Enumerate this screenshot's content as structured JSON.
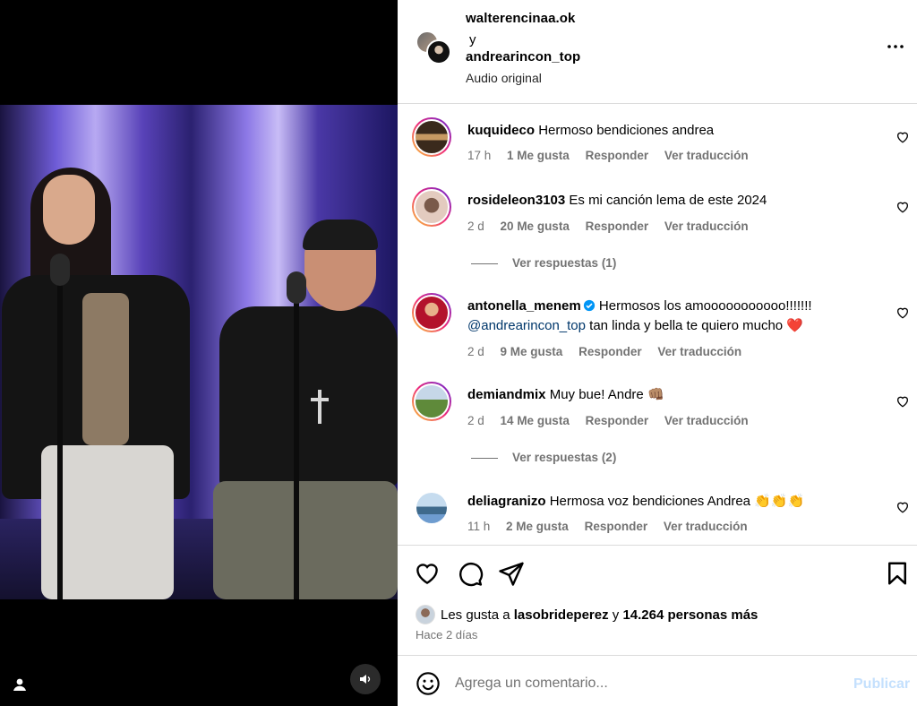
{
  "post": {
    "author1": "walterencinaa.ok",
    "joiner": "y",
    "author2": "andrearincon_top",
    "audio": "Audio original"
  },
  "comments": [
    {
      "user": "kuquideco",
      "text": "Hermoso bendiciones andrea",
      "time": "17 h",
      "likes": "1 Me gusta",
      "reply": "Responder",
      "translate": "Ver traducción",
      "avatar_colors": [
        "#3a2a1c",
        "#c79a63"
      ]
    },
    {
      "user": "rosideleon3103",
      "text": "Es mi canción lema de este 2024",
      "time": "2 d",
      "likes": "20 Me gusta",
      "reply": "Responder",
      "translate": "Ver traducción",
      "view_replies": "Ver respuestas (1)",
      "avatar_colors": [
        "#e3cbbf",
        "#7a5a4a"
      ]
    },
    {
      "user": "antonella_menem",
      "verified": true,
      "text": "Hermosos los amooooooooooo!!!!!!!",
      "mention": "@andrearincon_top",
      "text2": "tan linda y bella te quiero mucho",
      "emoji": "❤️",
      "time": "2 d",
      "likes": "9 Me gusta",
      "reply": "Responder",
      "translate": "Ver traducción",
      "avatar_colors": [
        "#b3122c",
        "#e8b08a"
      ]
    },
    {
      "user": "demiandmix",
      "text": "Muy bue! Andre",
      "emoji": "👊🏽",
      "time": "2 d",
      "likes": "14 Me gusta",
      "reply": "Responder",
      "translate": "Ver traducción",
      "view_replies": "Ver respuestas (2)",
      "avatar_colors": [
        "#5f8a3a",
        "#c6d7e8"
      ]
    },
    {
      "user": "deliagranizo",
      "text": "Hermosa voz bendiciones Andrea",
      "emoji": "👏👏👏",
      "time": "11 h",
      "likes": "2 Me gusta",
      "reply": "Responder",
      "translate": "Ver traducción",
      "avatar_colors": [
        "#6e9ccf",
        "#3f6a8c"
      ]
    }
  ],
  "likes": {
    "prefix": "Les gusta a",
    "user": "lasobrideperez",
    "joiner": "y",
    "others": "14.264 personas más"
  },
  "posted_ago": "Hace 2 días",
  "composer": {
    "placeholder": "Agrega un comentario...",
    "publish": "Publicar"
  },
  "icons": {
    "more": "more-horizontal-icon",
    "like": "heart-icon",
    "comment": "comment-bubble-icon",
    "share": "paper-plane-icon",
    "save": "bookmark-icon",
    "emoji": "smiley-icon",
    "audio": "speaker-icon",
    "profile": "user-icon"
  },
  "colors": {
    "link": "#00376b",
    "meta": "#737373",
    "divider": "#dbdbdb",
    "publish_disabled": "#c4e0fd",
    "heart_emoji": "#e0245e",
    "verified": "#0095f6"
  }
}
